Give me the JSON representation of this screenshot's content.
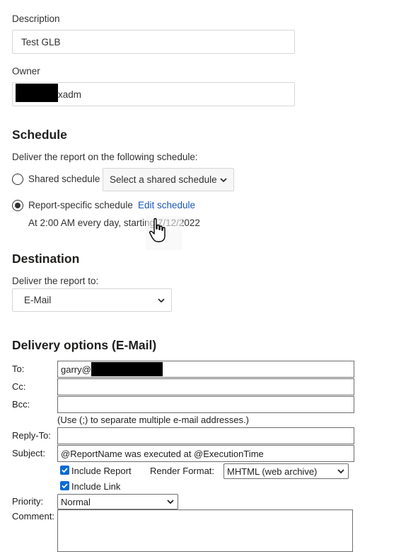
{
  "description": {
    "label": "Description",
    "value": "Test GLB"
  },
  "owner": {
    "label": "Owner",
    "value_visible": "xadm"
  },
  "schedule": {
    "heading": "Schedule",
    "intro": "Deliver the report on the following schedule:",
    "shared_label": "Shared schedule",
    "shared_select": "Select a shared schedule",
    "specific_label": "Report-specific schedule",
    "edit_link": "Edit schedule",
    "summary": "At 2:00 AM every day, starting 7/12/2022"
  },
  "destination": {
    "heading": "Destination",
    "intro": "Deliver the report to:",
    "selected": "E-Mail"
  },
  "delivery": {
    "heading": "Delivery options (E-Mail)",
    "to_label": "To:",
    "to_value_visible": "garry@",
    "cc_label": "Cc:",
    "bcc_label": "Bcc:",
    "hint": "(Use (;) to separate multiple e-mail addresses.)",
    "replyto_label": "Reply-To:",
    "subject_label": "Subject:",
    "subject_value": "@ReportName was executed at @ExecutionTime",
    "include_report": "Include Report",
    "render_format_label": "Render Format:",
    "render_format_value": "MHTML (web archive)",
    "include_link": "Include Link",
    "priority_label": "Priority:",
    "priority_value": "Normal",
    "comment_label": "Comment:"
  }
}
